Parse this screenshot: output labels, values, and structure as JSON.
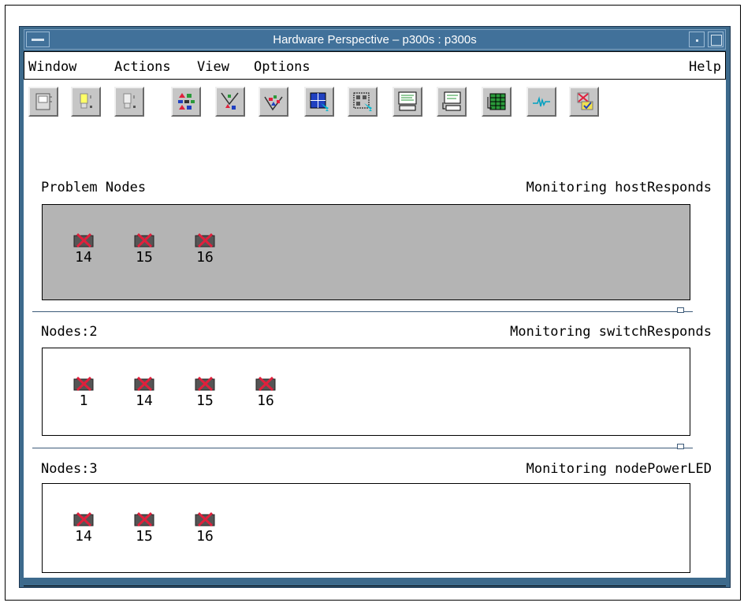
{
  "window": {
    "title": "Hardware Perspective – p300s : p300s"
  },
  "menubar": {
    "items": [
      "Window",
      "Actions",
      "View",
      "Options"
    ],
    "help": "Help"
  },
  "toolbar": {
    "buttons": [
      "notebook-icon",
      "lightbulb-on-icon",
      "lightbulb-off-icon",
      "shapes-grid-icon",
      "shapes-funnel-icon",
      "shapes-funnel-filled-icon",
      "grid-select-icon",
      "grid-deselect-icon",
      "screen-text-icon",
      "screen-keyboard-icon",
      "table-icon",
      "monitor-graph-icon",
      "cancel-check-icon"
    ]
  },
  "panes": [
    {
      "title": "Problem Nodes",
      "monitoring": "Monitoring hostResponds",
      "nodes": [
        "14",
        "15",
        "16"
      ]
    },
    {
      "title": "Nodes:2",
      "monitoring": "Monitoring switchResponds",
      "nodes": [
        "1",
        "14",
        "15",
        "16"
      ]
    },
    {
      "title": "Nodes:3",
      "monitoring": "Monitoring nodePowerLED",
      "nodes": [
        "14",
        "15",
        "16"
      ]
    }
  ],
  "colors": {
    "titlebar": "#41719a",
    "problem_pane": "#b4b4b4",
    "node_x": "#e0203c"
  }
}
